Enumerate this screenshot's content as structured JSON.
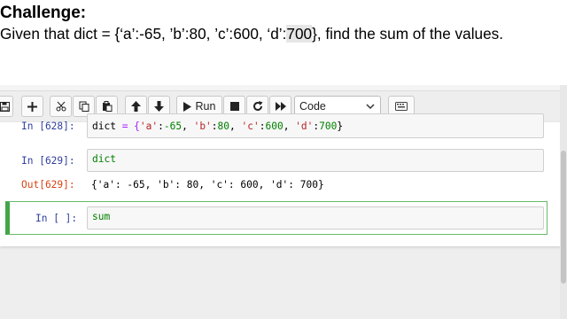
{
  "slide": {
    "heading": "Challenge:",
    "prompt_before": "Given that dict = {‘a’:-65, ’b’:80, ’c’:600, ‘d’:",
    "prompt_highlight": "700",
    "prompt_after": "}, find the sum of the values."
  },
  "toolbar": {
    "icons": [
      "save-icon",
      "plus-icon",
      "scissors-icon",
      "copy-icon",
      "paste-icon",
      "arrow-up-icon",
      "arrow-down-icon",
      "play-icon",
      "stop-icon",
      "restart-icon",
      "fast-forward-icon",
      "keyboard-icon"
    ],
    "run_label": "Run",
    "cell_type": "Code"
  },
  "cells": [
    {
      "prompt": "In [628]:",
      "code": {
        "var": "dict",
        "eq": " = {",
        "k1": "'a'",
        "c1": ":",
        "v1": "-65",
        "s1": ", ",
        "k2": "'b'",
        "c2": ":",
        "v2": "80",
        "s2": ", ",
        "k3": "'c'",
        "c3": ":",
        "v3": "600",
        "s3": ", ",
        "k4": "'d'",
        "c4": ":",
        "v4": "700",
        "end": "}"
      }
    },
    {
      "prompt": "In [629]:",
      "code": "dict",
      "out_prompt": "Out[629]:",
      "output": "{'a': -65, 'b': 80, 'c': 600, 'd': 700}"
    },
    {
      "prompt": "In [ ]:",
      "code": "sum"
    }
  ],
  "colors": {
    "input_prompt": "#303f9f",
    "output_prompt": "#d84315",
    "selected_cell": "#42a548"
  }
}
